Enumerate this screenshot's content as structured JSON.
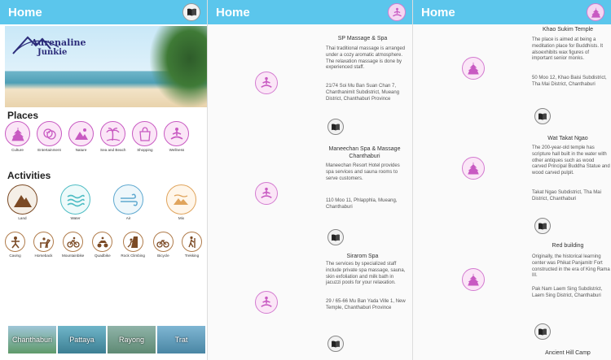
{
  "screen1": {
    "title": "Home",
    "logo": {
      "line1": "Adrenaline",
      "line2": "Junkie"
    },
    "places_title": "Places",
    "places": [
      {
        "label": "Culture",
        "icon": "temple-icon"
      },
      {
        "label": "Entertainment",
        "icon": "masks-icon"
      },
      {
        "label": "Nature",
        "icon": "mountains-icon"
      },
      {
        "label": "Sea and Beach",
        "icon": "palm-tree-icon"
      },
      {
        "label": "Shopping",
        "icon": "shopping-bag-icon"
      },
      {
        "label": "Wellness",
        "icon": "meditation-icon"
      }
    ],
    "activities_title": "Activities",
    "activities": [
      {
        "label": "Land",
        "icon": "mountain-icon"
      },
      {
        "label": "Water",
        "icon": "waves-icon"
      },
      {
        "label": "Air",
        "icon": "wind-icon"
      },
      {
        "label": "Mix",
        "icon": "mix-icon"
      }
    ],
    "sports": [
      {
        "label": "Caving",
        "icon": "caving-icon"
      },
      {
        "label": "Horseback",
        "icon": "horse-icon"
      },
      {
        "label": "Mountainbike",
        "icon": "bicycle-icon"
      },
      {
        "label": "Quadbike",
        "icon": "quadbike-icon"
      },
      {
        "label": "Rock Climbing",
        "icon": "climbing-icon"
      },
      {
        "label": "Bicycle",
        "icon": "bicycle-icon"
      },
      {
        "label": "Trekking",
        "icon": "hiker-icon"
      }
    ],
    "cities": [
      "Chanthaburi",
      "Pattaya",
      "Rayong",
      "Trat"
    ]
  },
  "screen2": {
    "title": "Home",
    "items": [
      {
        "name": "SP Massage & Spa",
        "desc": "Thai traditional massage is arranged under a cozy aromatic atmosphere. The relaxation massage is done by experienced staff.",
        "addr": "21/74 Soi Mu Ban Suan Chan 7, Chanthanimit Subdistrict, Mueang District, Chanthaburi Province"
      },
      {
        "name": "Maneechan Spa & Massage Chanthaburi",
        "desc": "Maneechan Resort Hotel provides spa services and sauna rooms to serve customers.",
        "addr": "110 Moo 11, Phlapphla, Mueang, Chanthaburi"
      },
      {
        "name": "Sirarom Spa",
        "desc": "The services by specialized staff include private spa massage, sauna, skin exfoliation and milk bath in jacuzzi pools for your relaxation.",
        "addr": "29 / 65-66 Mu Ban Yada Ville 1, New Temple, Chanthaburi Province"
      }
    ]
  },
  "screen3": {
    "title": "Home",
    "items": [
      {
        "name": "Khao Sukim Temple",
        "desc": "The place is aimed at being a meditation place for Buddhists. It alsoexhibits wax figures of important senior monks.",
        "addr": "50 Moo 12, Khao Baisi Subdistrict, Tha Mai District, Chanthaburi"
      },
      {
        "name": "Wat Takat Ngao",
        "desc": "The 200-year-old temple has scripture hall built in the water with other antiques such as wood carved Principal Buddha Statue and wood carved pulpit.",
        "addr": "Takat Ngao Subdistrict, Tha Mai District, Chanthaburi"
      },
      {
        "name": "Red building",
        "desc": "Originally, the historical learning center was Phikat Panjamitr Fort constructed in the era of King Rama III.",
        "addr": "Pak Nam Laem Sing Subdistrict, Laem Sing District, Chanthaburi"
      },
      {
        "name": "Ancient Hill Camp"
      }
    ]
  },
  "colors": {
    "topbar": "#5bc6ec",
    "accent_pink": "#c85ac2",
    "brown": "#7b4a25"
  }
}
